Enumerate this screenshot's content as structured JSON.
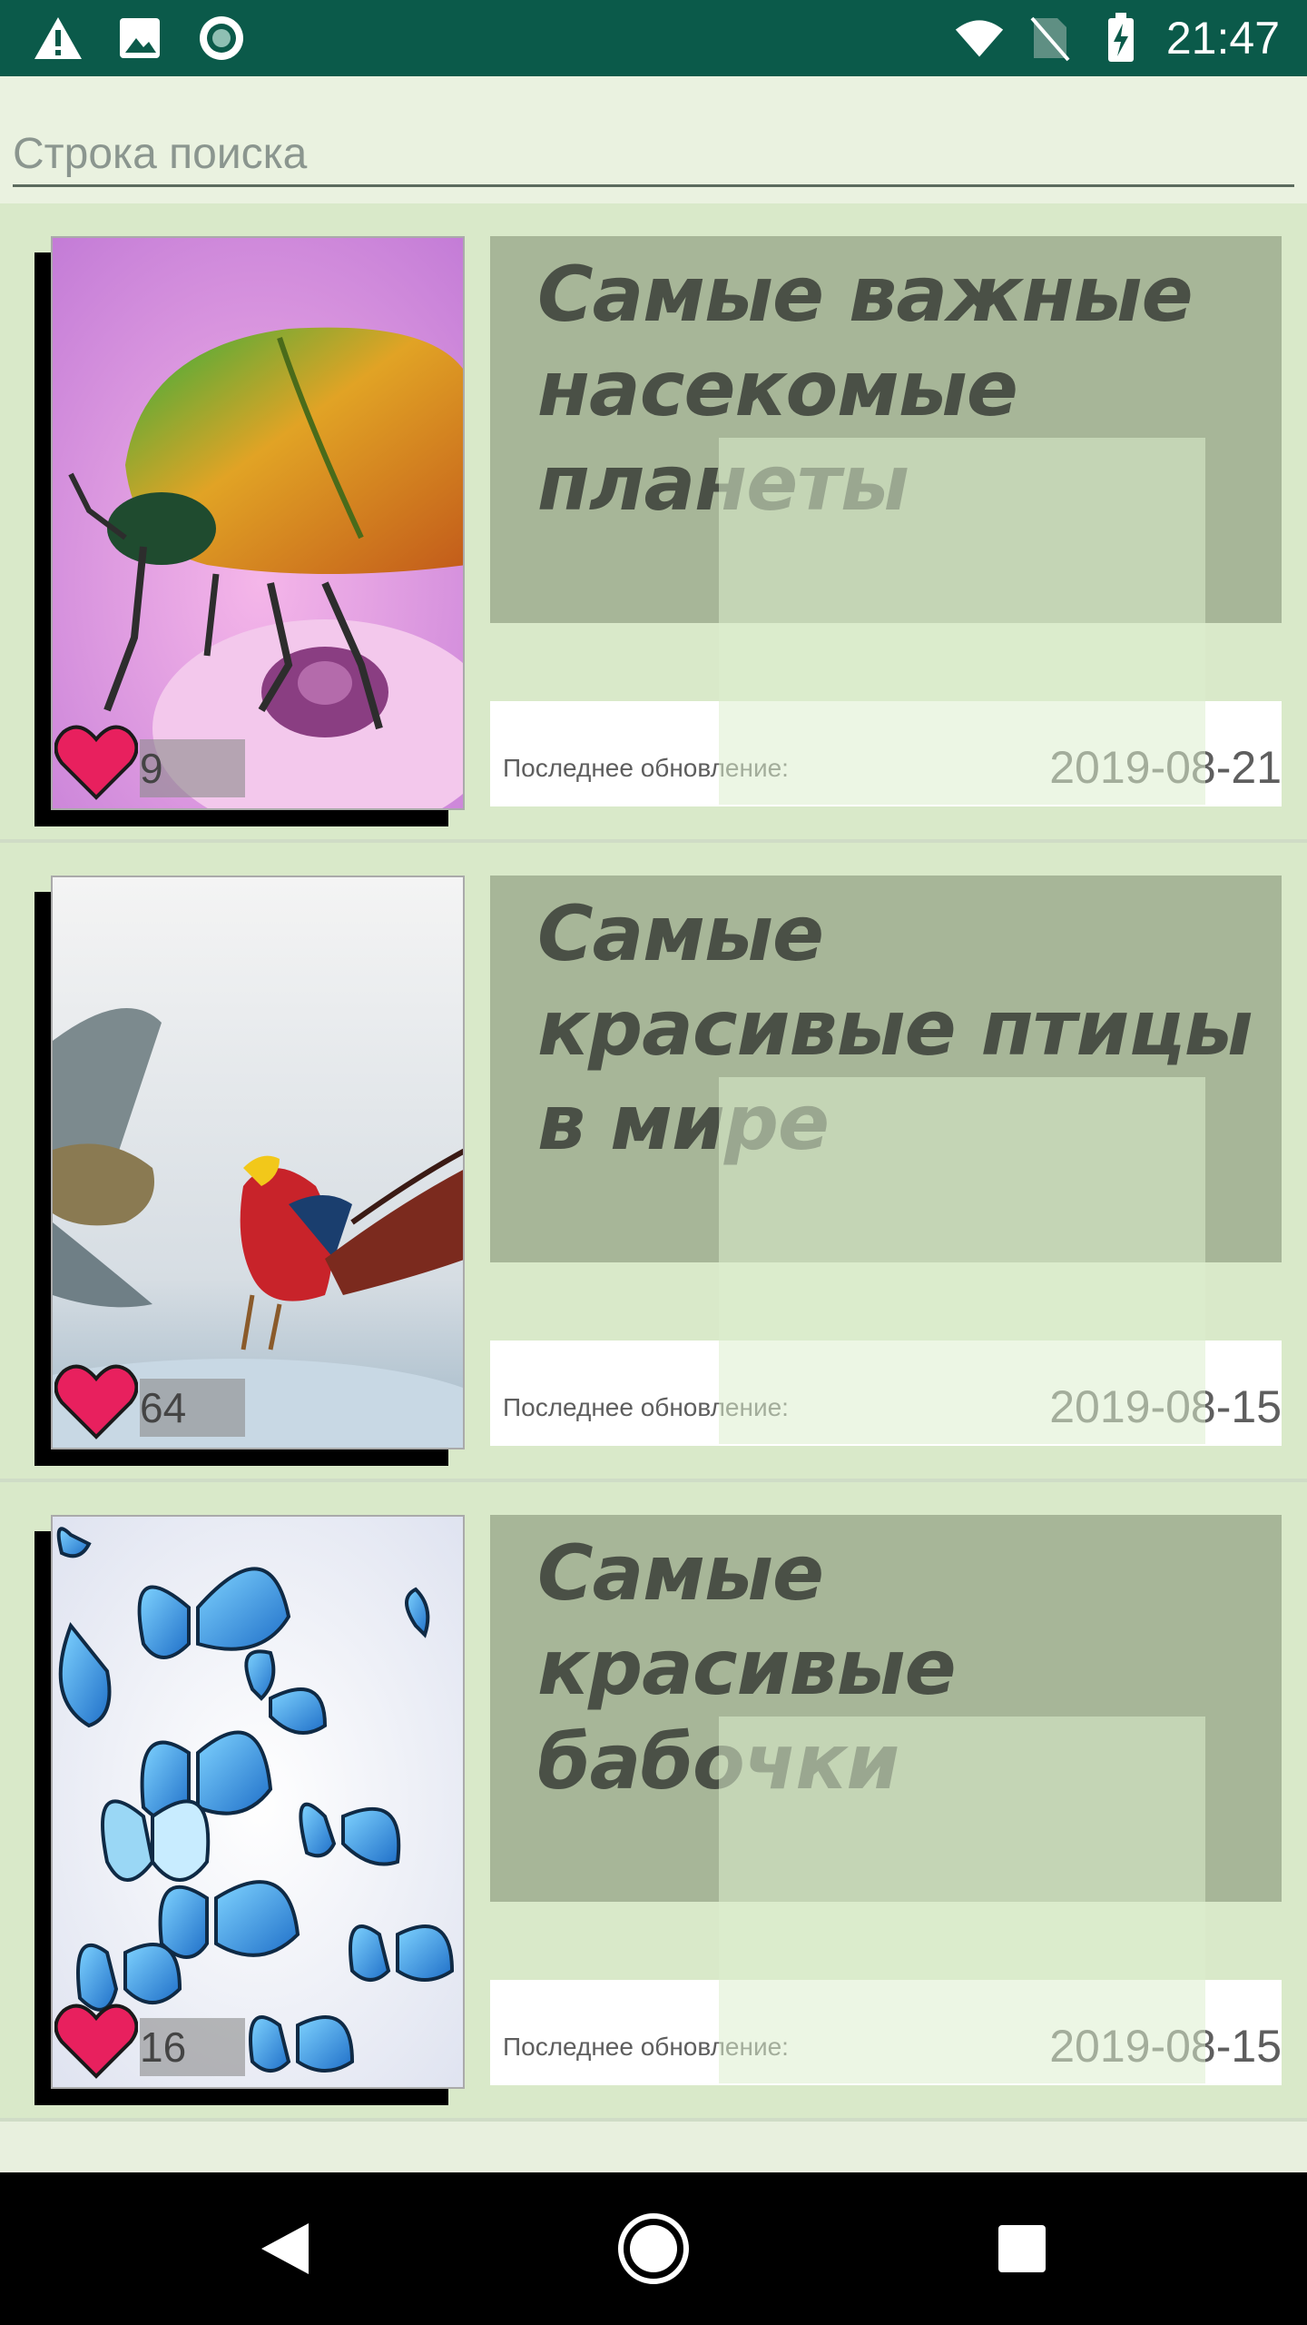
{
  "status_bar": {
    "time": "21:47",
    "icons": [
      "warning-icon",
      "image-icon",
      "record-icon",
      "wifi-icon",
      "no-sim-icon",
      "battery-charging-icon"
    ]
  },
  "search": {
    "placeholder": "Строка поиска"
  },
  "items": [
    {
      "title": "Самые важные насекомые планеты",
      "likes": "9",
      "updated_label": "Последнее обновление:",
      "date": "2019-08-21"
    },
    {
      "title": "Самые красивые птицы в мире",
      "likes": "64",
      "updated_label": "Последнее обновление:",
      "date": "2019-08-15"
    },
    {
      "title": "Самые красивые бабочки",
      "likes": "16",
      "updated_label": "Последнее обновление:",
      "date": "2019-08-15"
    }
  ],
  "nav": {
    "buttons": [
      "back-icon",
      "home-icon",
      "recents-icon"
    ]
  },
  "colors": {
    "status_bar": "#0b5a4a",
    "title_box": "#a7b698",
    "list_bg": "#d9e9c9",
    "heart": "#e8205e"
  }
}
